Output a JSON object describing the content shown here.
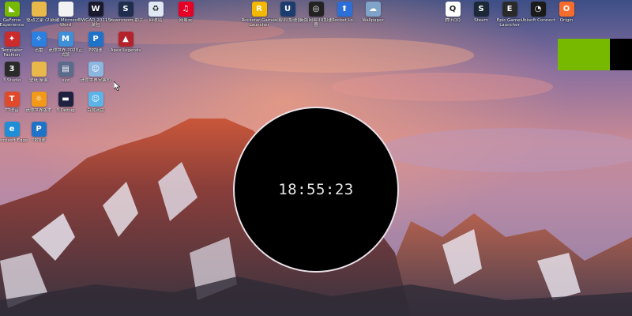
{
  "clock": {
    "time": "18:55:23"
  },
  "desktop_icons": [
    {
      "label": "GeForce Experience",
      "icon": "nvidia-icon",
      "color": "#76b900",
      "glyph": "◣",
      "col": 0,
      "row": 0
    },
    {
      "label": "驱动之家 (2)",
      "icon": "folder-icon",
      "color": "#e8b84a",
      "glyph": "",
      "col": 1,
      "row": 0
    },
    {
      "label": "新建 Microsoft Word",
      "icon": "document-icon",
      "color": "#f2f2f2",
      "glyph": "",
      "col": 2,
      "row": 0
    },
    {
      "label": "OWGAD 2021 安装包",
      "icon": "app-icon",
      "color": "#1a1a2e",
      "glyph": "W",
      "col": 3,
      "row": 0
    },
    {
      "label": "Steamroom 助手",
      "icon": "app-icon",
      "color": "#1f2e4d",
      "glyph": "S",
      "col": 4,
      "row": 0
    },
    {
      "label": "回收站",
      "icon": "recycle-bin-icon",
      "color": "#dfe9f3",
      "glyph": "♻",
      "col": 5,
      "row": 0
    },
    {
      "label": "网易云",
      "icon": "netease-music-icon",
      "color": "#e60026",
      "glyph": "♫",
      "col": 6,
      "row": 0
    },
    {
      "label": "Templater Fashion",
      "icon": "app-icon",
      "color": "#cc2b2b",
      "glyph": "✦",
      "col": 0,
      "row": 1
    },
    {
      "label": "迅雷",
      "icon": "xunlei-icon",
      "color": "#2a7fe0",
      "glyph": "✧",
      "col": 1,
      "row": 1
    },
    {
      "label": "迷你世界 2020正式版",
      "icon": "game-icon",
      "color": "#3f8fd8",
      "glyph": "M",
      "col": 2,
      "row": 1
    },
    {
      "label": "PP加速",
      "icon": "accelerator-icon",
      "color": "#1e73c8",
      "glyph": "P",
      "col": 3,
      "row": 1
    },
    {
      "label": "Apex Legends",
      "icon": "apex-icon",
      "color": "#b4232b",
      "glyph": "▲",
      "col": 4,
      "row": 1
    },
    {
      "label": "3 Studio",
      "icon": "app-icon",
      "color": "#2a2a2a",
      "glyph": "3",
      "col": 0,
      "row": 2
    },
    {
      "label": "壁纸 桌面",
      "icon": "folder-icon",
      "color": "#e8b84a",
      "glyph": "",
      "col": 1,
      "row": 2
    },
    {
      "label": "xyz",
      "icon": "file-icon",
      "color": "#5a6b8c",
      "glyph": "▤",
      "col": 2,
      "row": 2
    },
    {
      "label": "迷你世界安装包",
      "icon": "game-icon",
      "color": "#8ab6e0",
      "glyph": "☺",
      "col": 3,
      "row": 2
    },
    {
      "label": "TT语音",
      "icon": "app-icon",
      "color": "#e04a2a",
      "glyph": "T",
      "col": 0,
      "row": 3
    },
    {
      "label": "迷你世界版本",
      "icon": "app-icon",
      "color": "#f29a18",
      "glyph": "☼",
      "col": 1,
      "row": 3
    },
    {
      "label": "3 Debug",
      "icon": "app-icon",
      "color": "#202040",
      "glyph": "▬",
      "col": 2,
      "row": 3
    },
    {
      "label": "百度网盘",
      "icon": "app-icon",
      "color": "#5cb3e8",
      "glyph": "☺",
      "col": 3,
      "row": 3
    },
    {
      "label": "Microsoft Edge",
      "icon": "edge-icon",
      "color": "#1f8ed6",
      "glyph": "e",
      "col": 0,
      "row": 4
    },
    {
      "label": "PP加速",
      "icon": "accelerator-icon",
      "color": "#1e73c8",
      "glyph": "P",
      "col": 1,
      "row": 4
    },
    {
      "label": "Rockstar Games Launcher",
      "icon": "rockstar-icon",
      "color": "#f5b800",
      "glyph": "R",
      "col": 9,
      "row": 0,
      "top": true
    },
    {
      "label": "网易UU加速器",
      "icon": "uu-accelerator-icon",
      "color": "#1b3c6e",
      "glyph": "U",
      "col": 10,
      "row": 0,
      "top": true
    },
    {
      "label": "新版网易UU加速器",
      "icon": "uu-accelerator-icon",
      "color": "#222",
      "glyph": "◎",
      "col": 11,
      "row": 0,
      "top": true
    },
    {
      "label": "Rocket Lo...",
      "icon": "rocket-icon",
      "color": "#2c6fd6",
      "glyph": "⬆",
      "col": 12,
      "row": 0,
      "top": true
    },
    {
      "label": "Wallpaper",
      "icon": "wallpaper-engine-icon",
      "color": "#7fa3c9",
      "glyph": "☁",
      "col": 13,
      "row": 0,
      "top": true
    },
    {
      "label": "腾讯QQ",
      "icon": "qq-icon",
      "color": "#ffffff",
      "glyph": "Q",
      "col": 17,
      "row": 0,
      "top": true
    },
    {
      "label": "Steam",
      "icon": "steam-icon",
      "color": "#1b2838",
      "glyph": "S",
      "col": 18,
      "row": 0,
      "top": true
    },
    {
      "label": "Epic Games Launcher",
      "icon": "epic-games-icon",
      "color": "#2a2a2a",
      "glyph": "E",
      "col": 19,
      "row": 0,
      "top": true
    },
    {
      "label": "Ubisoft Connect",
      "icon": "ubisoft-icon",
      "color": "#1a1a1a",
      "glyph": "◔",
      "col": 20,
      "row": 0,
      "top": true
    },
    {
      "label": "Origin",
      "icon": "origin-icon",
      "color": "#f56c2d",
      "glyph": "O",
      "col": 21,
      "row": 0,
      "top": true
    }
  ],
  "colors": {
    "widget_green": "#76b900",
    "clock_bg": "#000000"
  }
}
